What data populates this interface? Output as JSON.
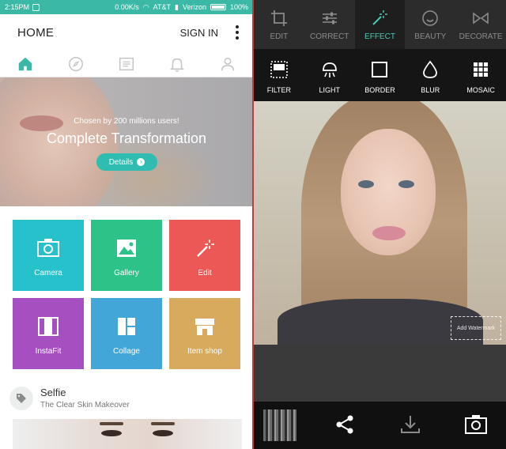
{
  "left": {
    "status": {
      "time": "2:15PM",
      "speed": "0.00K/s",
      "carrier1": "AT&T",
      "carrier2": "Verizon",
      "battery": "100%"
    },
    "header": {
      "home_label": "HOME",
      "signin_label": "SIGN IN"
    },
    "nav_tabs": [
      {
        "icon": "home-icon",
        "active": true
      },
      {
        "icon": "compass-icon",
        "active": false
      },
      {
        "icon": "list-icon",
        "active": false
      },
      {
        "icon": "bell-icon",
        "active": false
      },
      {
        "icon": "user-icon",
        "active": false
      }
    ],
    "hero": {
      "tagline": "Chosen by 200 millions users!",
      "headline": "Complete Transformation",
      "details_label": "Details"
    },
    "tiles": [
      {
        "label": "Camera",
        "color": "#27c1cc",
        "icon": "camera-icon"
      },
      {
        "label": "Gallery",
        "color": "#2cc288",
        "icon": "image-icon"
      },
      {
        "label": "Edit",
        "color": "#ec5855",
        "icon": "magic-wand-icon"
      },
      {
        "label": "InstaFit",
        "color": "#a54fc1",
        "icon": "instafit-icon"
      },
      {
        "label": "Collage",
        "color": "#42a6d8",
        "icon": "collage-icon"
      },
      {
        "label": "Item shop",
        "color": "#d7aa5d",
        "icon": "shop-icon"
      }
    ],
    "selfie": {
      "title": "Selfie",
      "subtitle": "The Clear Skin Makeover"
    },
    "accent": "#3cb9a6"
  },
  "right": {
    "tools": [
      {
        "label": "EDIT",
        "icon": "crop-icon",
        "active": false
      },
      {
        "label": "CORRECT",
        "icon": "sliders-icon",
        "active": false
      },
      {
        "label": "EFFECT",
        "icon": "sparkle-wand-icon",
        "active": true
      },
      {
        "label": "BEAUTY",
        "icon": "smiley-icon",
        "active": false
      },
      {
        "label": "DECORATE",
        "icon": "bow-icon",
        "active": false
      }
    ],
    "effects": [
      {
        "label": "FILTER",
        "icon": "filter-icon"
      },
      {
        "label": "LIGHT",
        "icon": "light-icon"
      },
      {
        "label": "BORDER",
        "icon": "border-icon"
      },
      {
        "label": "BLUR",
        "icon": "drop-icon"
      },
      {
        "label": "MOSAIC",
        "icon": "mosaic-icon"
      }
    ],
    "watermark_label": "Add Watermark",
    "accent": "#48c8b7"
  }
}
